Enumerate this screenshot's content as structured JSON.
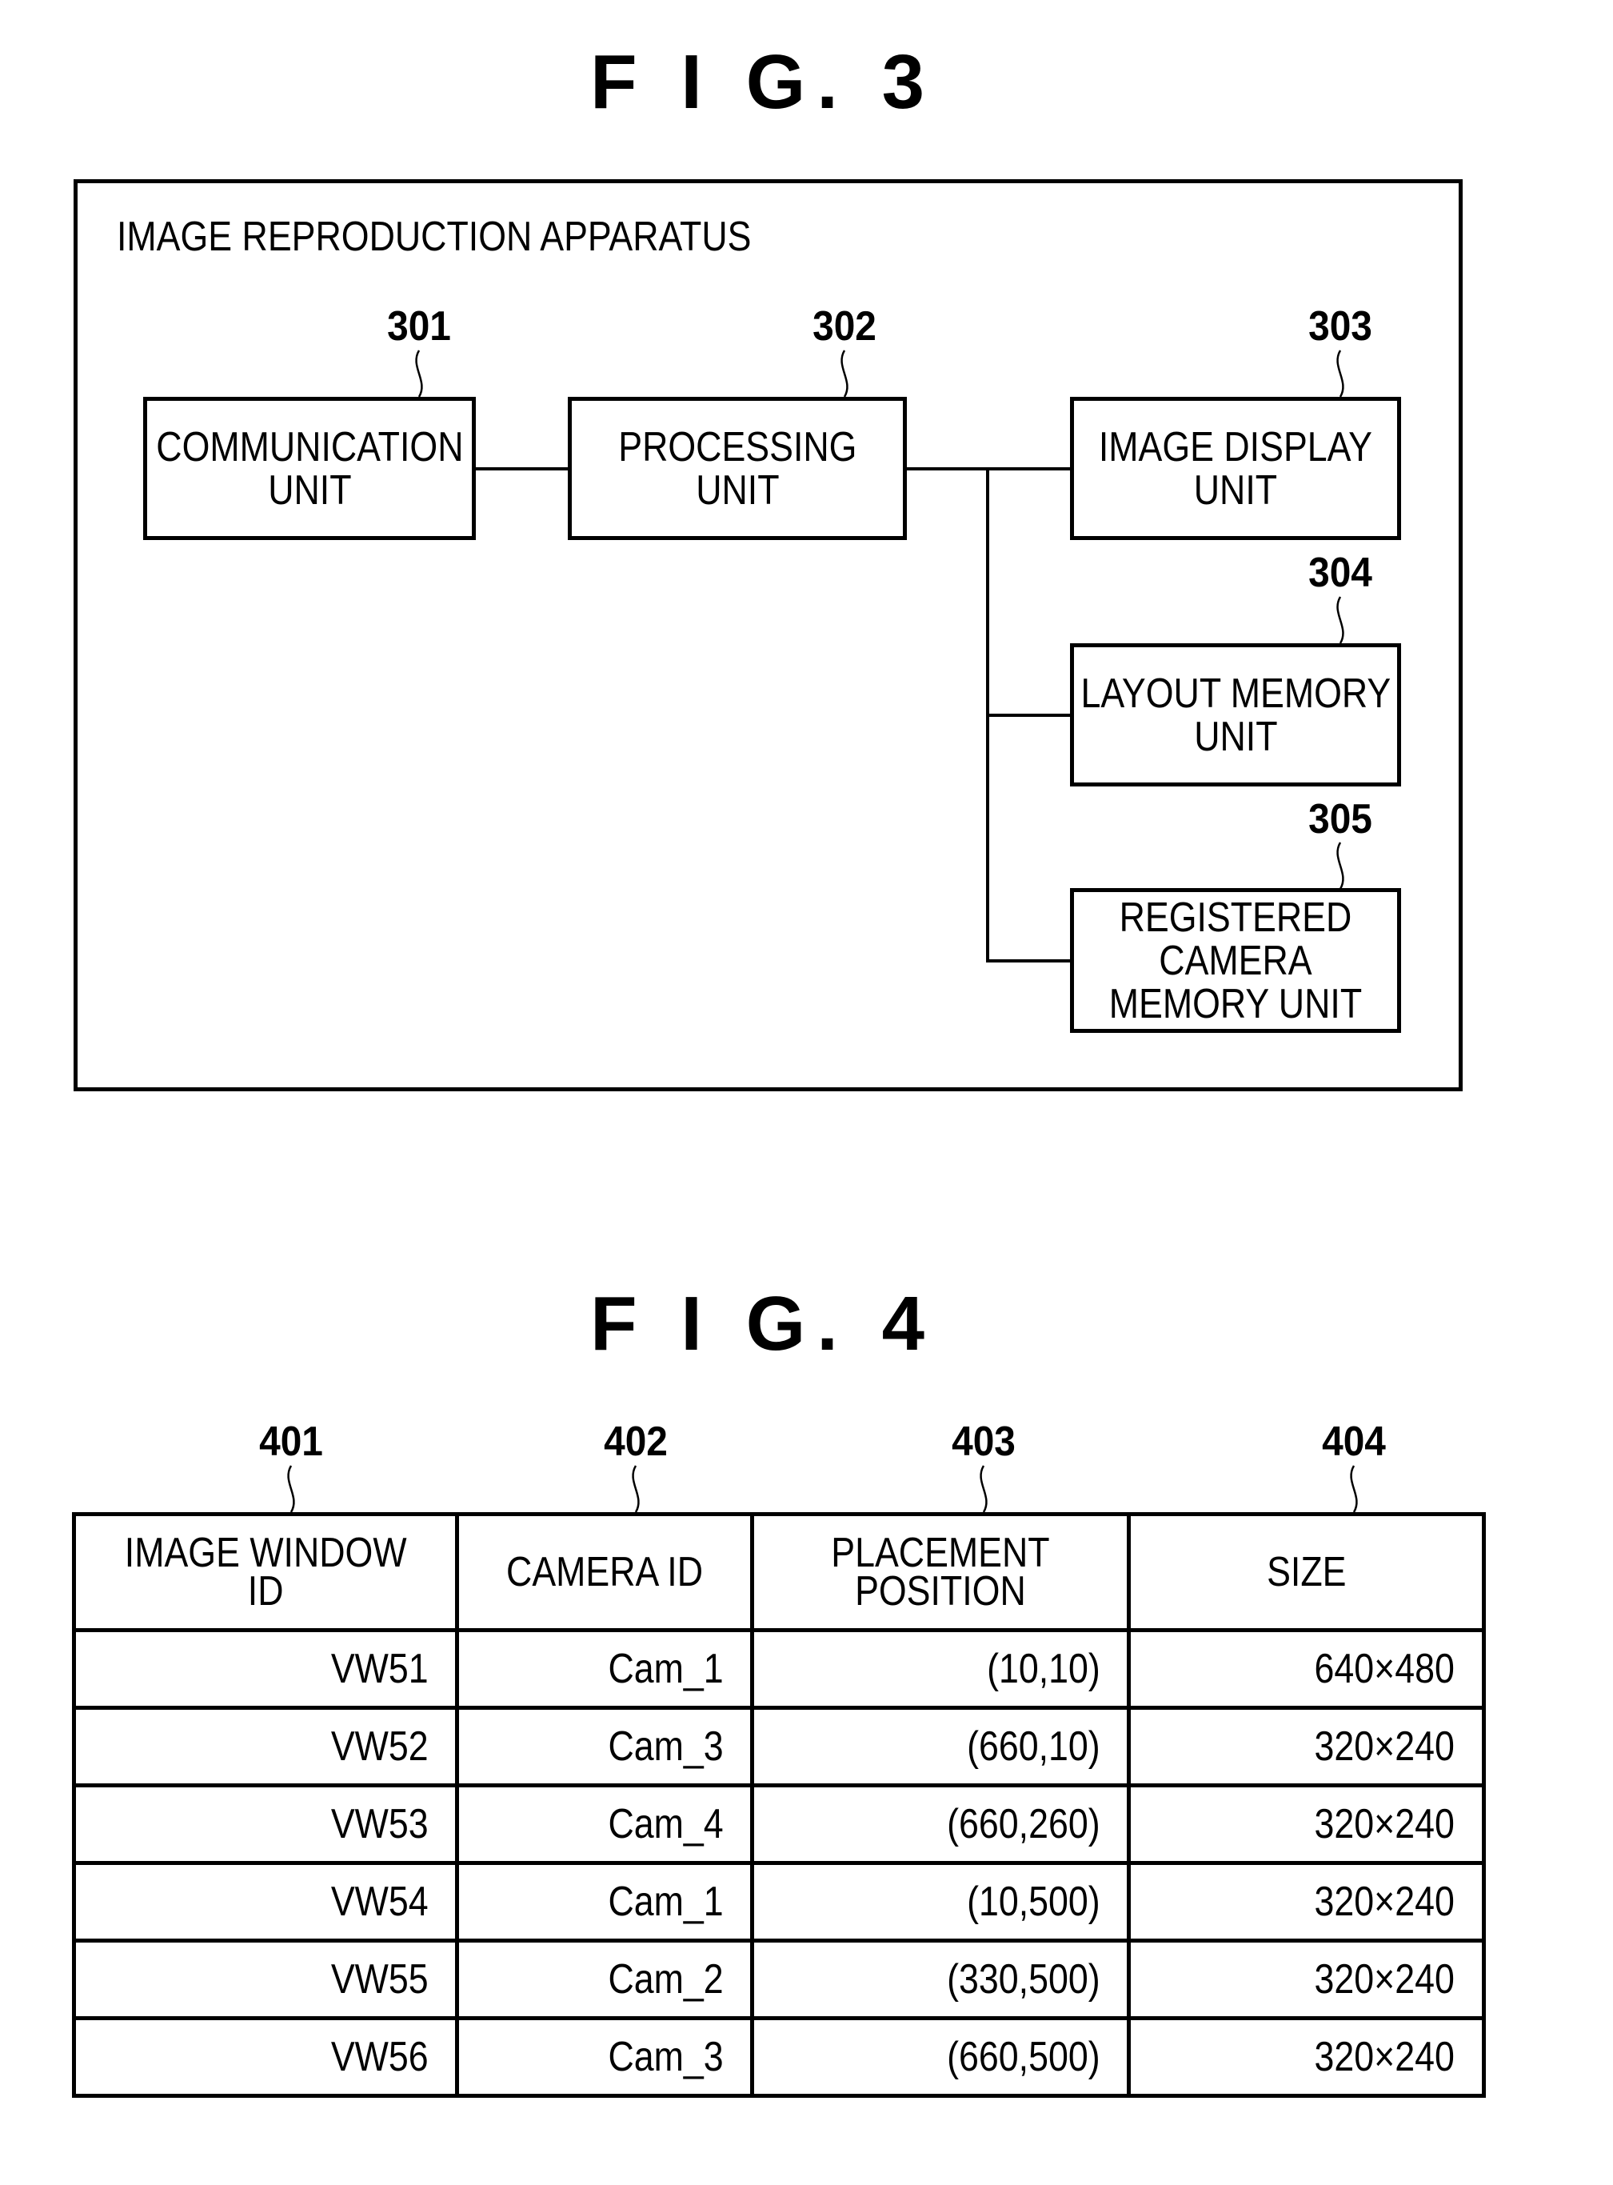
{
  "fig3": {
    "title": "F I G. 3",
    "container_label": "IMAGE REPRODUCTION APPARATUS",
    "blocks": [
      {
        "ref": "301",
        "lines": [
          "COMMUNICATION",
          "UNIT"
        ]
      },
      {
        "ref": "302",
        "lines": [
          "PROCESSING",
          "UNIT"
        ]
      },
      {
        "ref": "303",
        "lines": [
          "IMAGE DISPLAY",
          "UNIT"
        ]
      },
      {
        "ref": "304",
        "lines": [
          "LAYOUT MEMORY",
          "UNIT"
        ]
      },
      {
        "ref": "305",
        "lines": [
          "REGISTERED",
          "CAMERA",
          "MEMORY UNIT"
        ]
      }
    ]
  },
  "fig4": {
    "title": "F I G. 4",
    "column_refs": [
      "401",
      "402",
      "403",
      "404"
    ],
    "headers": [
      [
        "IMAGE WINDOW ID"
      ],
      [
        "CAMERA ID"
      ],
      [
        "PLACEMENT",
        "POSITION"
      ],
      [
        "SIZE"
      ]
    ],
    "rows": [
      [
        "VW51",
        "Cam_1",
        "(10,10)",
        "640×480"
      ],
      [
        "VW52",
        "Cam_3",
        "(660,10)",
        "320×240"
      ],
      [
        "VW53",
        "Cam_4",
        "(660,260)",
        "320×240"
      ],
      [
        "VW54",
        "Cam_1",
        "(10,500)",
        "320×240"
      ],
      [
        "VW55",
        "Cam_2",
        "(330,500)",
        "320×240"
      ],
      [
        "VW56",
        "Cam_3",
        "(660,500)",
        "320×240"
      ]
    ]
  }
}
